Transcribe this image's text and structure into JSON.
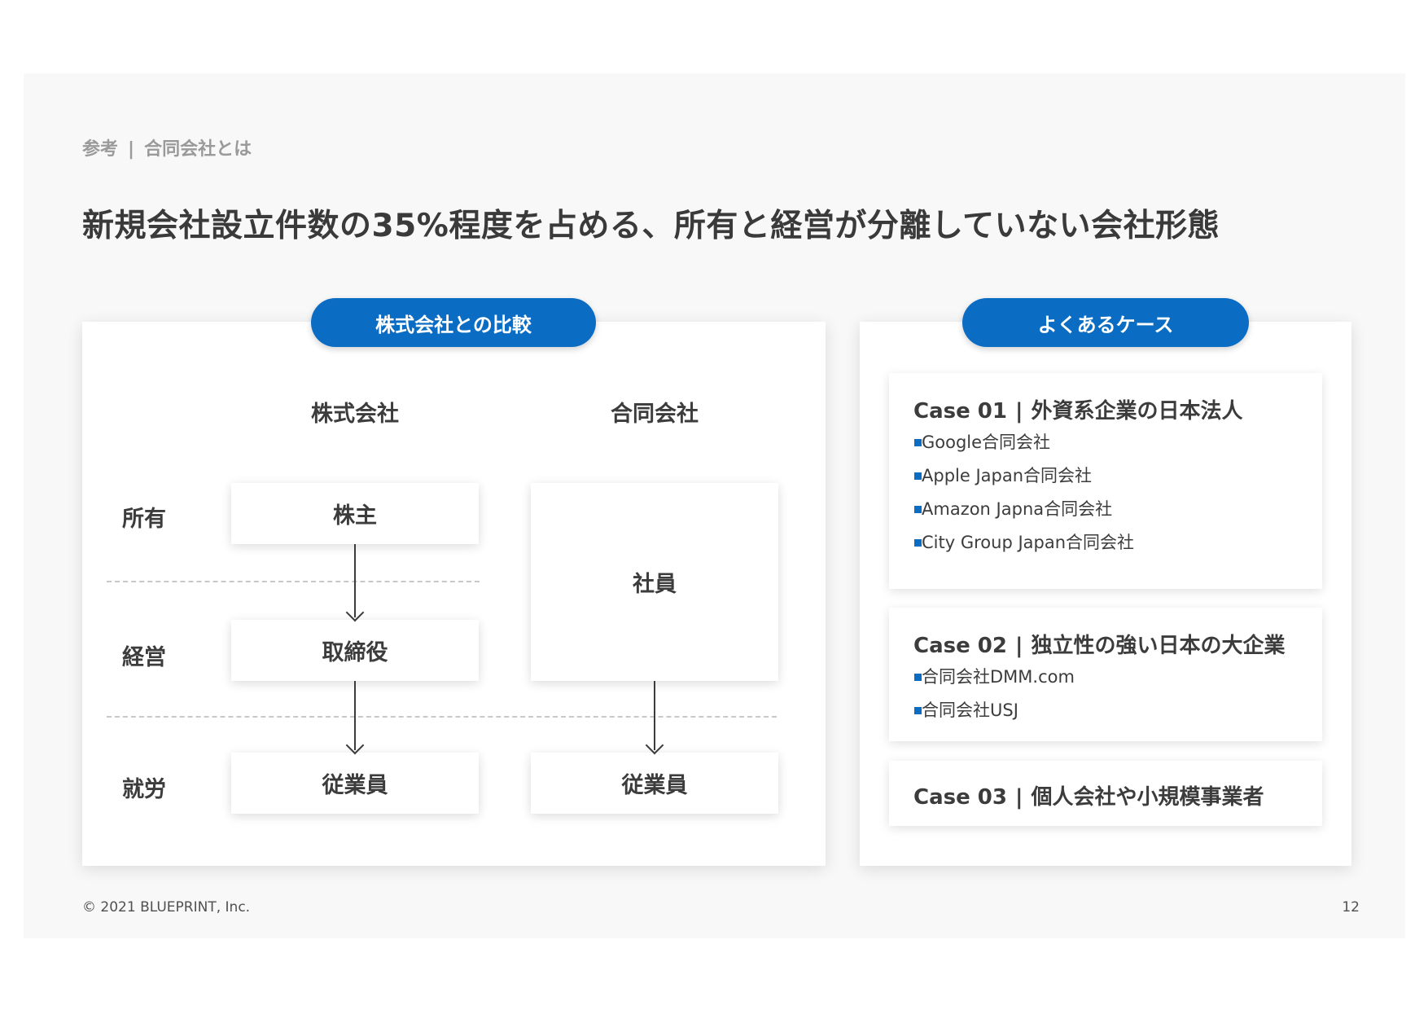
{
  "header": {
    "category": "参考",
    "separator": "|",
    "topic": "合同会社とは"
  },
  "title": "新規会社設立件数の35%程度を占める、所有と経営が分離していない会社形態",
  "comparison": {
    "pill": "株式会社との比較",
    "col_kabushiki": "株式会社",
    "col_godo": "合同会社",
    "row_ownership": "所有",
    "row_management": "経営",
    "row_labor": "就労",
    "kabushiki_owner": "株主",
    "kabushiki_manager": "取締役",
    "kabushiki_employee": "従業員",
    "godo_member": "社員",
    "godo_employee": "従業員"
  },
  "cases": {
    "pill": "よくあるケース",
    "items": [
      {
        "label": "Case 01",
        "bar": "|",
        "title": "外資系企業の日本法人",
        "bullets": [
          "Google合同会社",
          "Apple Japan合同会社",
          "Amazon Japna合同会社",
          "City Group Japan合同会社"
        ]
      },
      {
        "label": "Case 02",
        "bar": "|",
        "title": "独立性の強い日本の大企業",
        "bullets": [
          "合同会社DMM.com",
          "合同会社USJ"
        ]
      },
      {
        "label": "Case 03",
        "bar": "|",
        "title": "個人会社や小規模事業者",
        "bullets": []
      }
    ]
  },
  "footer": {
    "copyright": "© 2021 BLUEPRINT, Inc.",
    "page": "12"
  },
  "colors": {
    "accent": "#0a6cc2",
    "slide_bg": "#f8f8f8",
    "text": "#3c3c3c"
  }
}
